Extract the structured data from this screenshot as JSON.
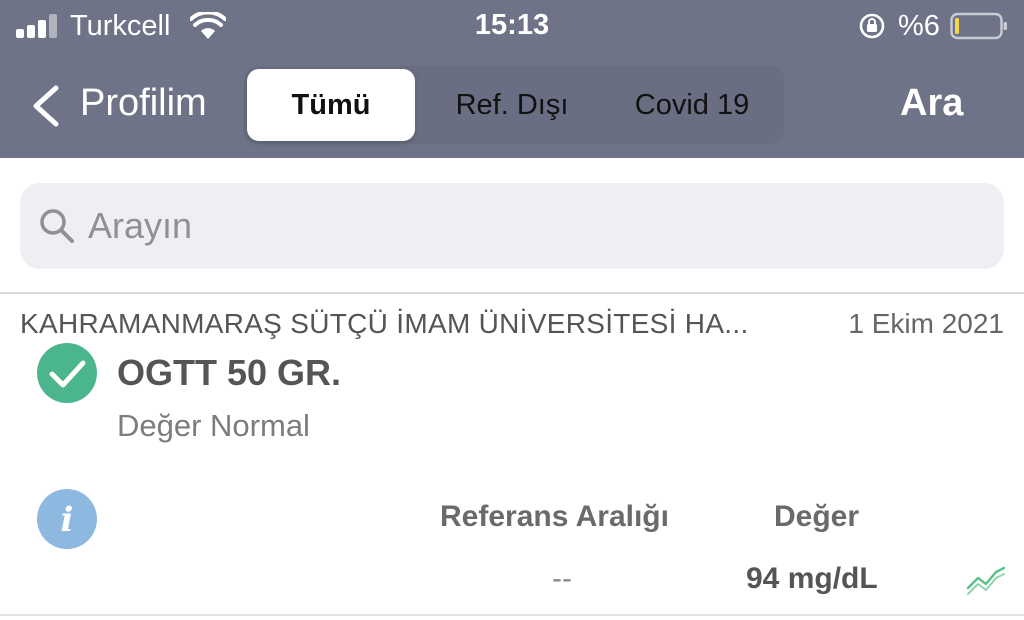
{
  "status_bar": {
    "carrier": "Turkcell",
    "time": "15:13",
    "battery_percent": "%6",
    "icons": [
      "signal-icon",
      "wifi-icon",
      "rotation-lock-icon",
      "battery-icon"
    ]
  },
  "nav": {
    "back_label": "Profilim",
    "segments": [
      "Tümü",
      "Ref. Dışı",
      "Covid 19"
    ],
    "selected_segment": "Tümü",
    "search_action": "Ara"
  },
  "search": {
    "placeholder": "Arayın"
  },
  "result": {
    "hospital": "KAHRAMANMARAŞ SÜTÇÜ İMAM ÜNİVERSİTESİ  HA...",
    "date": "1 Ekim 2021",
    "test_name": "OGTT 50 GR.",
    "status": "Değer Normal",
    "reference_header": "Referans Aralığı",
    "value_header": "Değer",
    "reference_value": "--",
    "value": "94 mg/dL",
    "icons": [
      "check-icon",
      "info-icon",
      "trend-chart-icon"
    ]
  },
  "colors": {
    "header_bg": "#6f7387",
    "success_green": "#4bb58d",
    "info_blue": "#8db8e0",
    "search_bg": "#efeff3"
  }
}
